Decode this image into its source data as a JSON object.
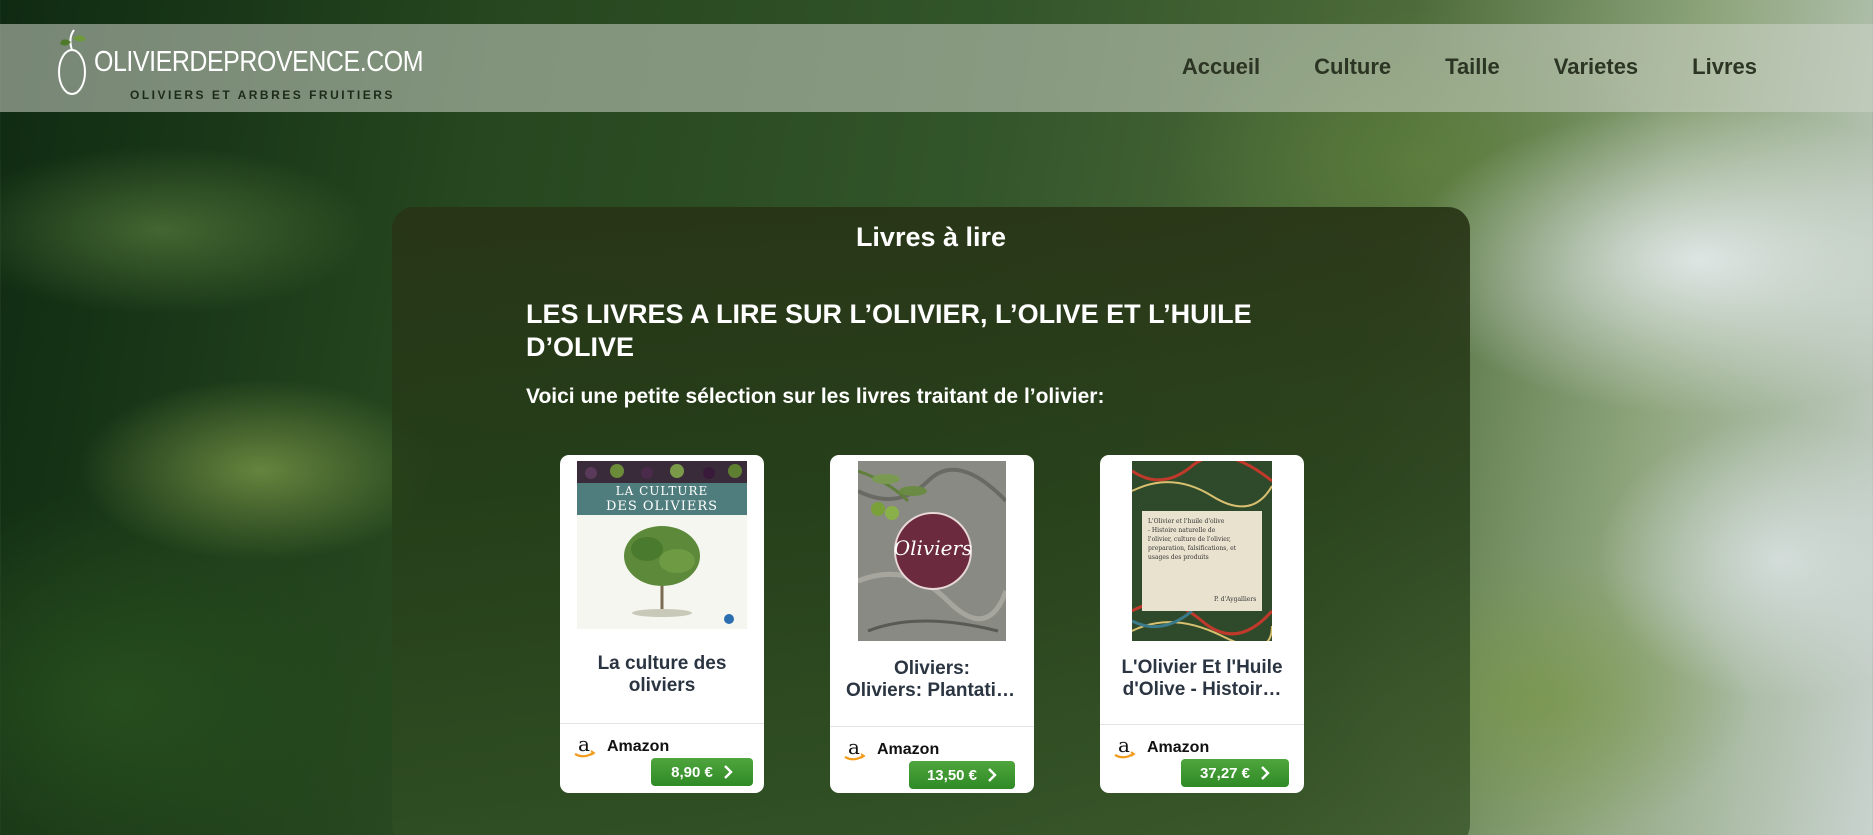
{
  "header": {
    "logo_text": "OLIVIERDEPROVENCE.COM",
    "logo_subtitle": "OLIVIERS ET ARBRES FRUITIERS",
    "nav": [
      "Accueil",
      "Culture",
      "Taille",
      "Varietes",
      "Livres"
    ]
  },
  "panel": {
    "title": "Livres à lire",
    "heading": "LES LIVRES A LIRE SUR L’OLIVIER, L’OLIVE ET L’HUILE D’OLIVE",
    "intro": "Voici une petite sélection sur les livres traitant de l’olivier:"
  },
  "books": [
    {
      "title": "La culture des oliviers",
      "cover_title": "LA CULTURE DES OLIVIERS",
      "store": "Amazon",
      "price": "8,90 €"
    },
    {
      "title": "Oliviers: Plantation - Entretien - Recettes",
      "display_title": "Oliviers: Plantation -…",
      "cover_title": "Oliviers",
      "store": "Amazon",
      "price": "13,50 €"
    },
    {
      "title": "L'Olivier Et l'Huile d'Olive - Histoire",
      "display_title_line1": "L'Olivier Et l'Huile",
      "display_title_line2": "d'Olive - Histoir…",
      "cover_text": "L'Olivier et l'huile d'olive - Histoire naturelle de l'olivier, culture de l'olivier, preparation, falsifications, et usages des produits",
      "cover_author": "P. d'Aygalliers",
      "store": "Amazon",
      "price": "37,27 €"
    }
  ],
  "colors": {
    "price_button": "#3a9a2e",
    "panel_bg": "#2a3a1c",
    "nav_text": "#2c3423"
  }
}
